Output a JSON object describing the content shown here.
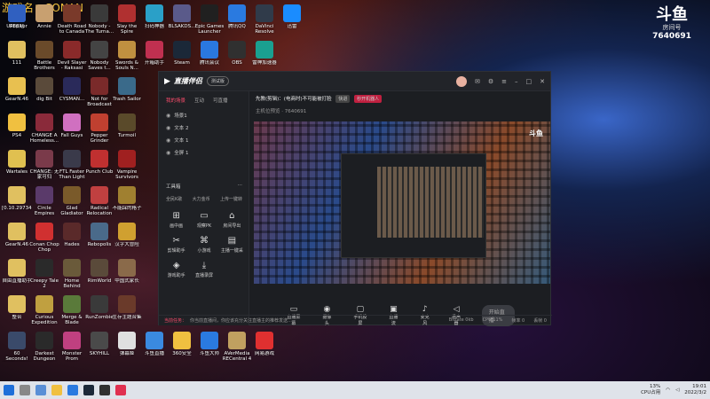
{
  "overlay": {
    "name": "游戏名：CONAN",
    "logo": "斗鱼",
    "room_label": "房间号",
    "room_id": "7640691"
  },
  "desktop_icons": [
    {
      "label": "回收站",
      "color": "#5a8fd6"
    },
    {
      "label": "Annie",
      "color": "#c8a070"
    },
    {
      "label": "Death Road to Canada",
      "color": "#7a3a2a"
    },
    {
      "label": "Nobody - The Turna...",
      "color": "#3a3a3a"
    },
    {
      "label": "Slay the Spire",
      "color": "#b03030"
    },
    {
      "label": "扫码神器",
      "color": "#2aa0c8"
    },
    {
      "label": "BLSAKDS...",
      "color": "#5a5a8a"
    },
    {
      "label": "Epic Games Launcher",
      "color": "#202020"
    },
    {
      "label": "腾讯QQ",
      "color": "#2a7ae0"
    },
    {
      "label": "DaVinci Resolve",
      "color": "#303b4a"
    },
    {
      "label": "迅雷",
      "color": "#1a8cff"
    },
    {
      "label": "111",
      "color": "#e0c060"
    },
    {
      "label": "Battle Brothers",
      "color": "#6a4a2a"
    },
    {
      "label": "Devil Slayer - Raksasi",
      "color": "#8a2a2a"
    },
    {
      "label": "Nobody Saves t...",
      "color": "#444"
    },
    {
      "label": "Swords & Souls N...",
      "color": "#c09040"
    },
    {
      "label": "开箱助手",
      "color": "#c03050"
    },
    {
      "label": "Steam",
      "color": "#1b2838"
    },
    {
      "label": "腾讯会议",
      "color": "#2a78e0"
    },
    {
      "label": "OBS",
      "color": "#303030"
    },
    {
      "label": "雷神加速器",
      "color": "#1aa090"
    },
    {
      "label": "GearN.46",
      "color": "#e8c050"
    },
    {
      "label": "dig Bit",
      "color": "#5a4a3a"
    },
    {
      "label": "CYSMAN...",
      "color": "#2a2a5a"
    },
    {
      "label": "Not for Broadcast",
      "color": "#7a2a2a"
    },
    {
      "label": "Trash Sailor",
      "color": "#3a6a8a"
    },
    {
      "label": "PS4",
      "color": "#f0c040"
    },
    {
      "label": "CHANGE A Homeless...",
      "color": "#8a2a3a"
    },
    {
      "label": "Fall Guys",
      "color": "#d070c0"
    },
    {
      "label": "Pepper Grinder",
      "color": "#c04030"
    },
    {
      "label": "Turmoil",
      "color": "#5a4a2a"
    },
    {
      "label": "Wartales",
      "color": "#e0c050"
    },
    {
      "label": "CHANGE: 无家可归",
      "color": "#7a3a4a"
    },
    {
      "label": "FTL Faster Than Light",
      "color": "#3a3a4a"
    },
    {
      "label": "Punch Club",
      "color": "#c03030"
    },
    {
      "label": "Vampire Survivors",
      "color": "#a02020"
    },
    {
      "label": "[0.10.29734]",
      "color": "#e0c060"
    },
    {
      "label": "Circle Empires",
      "color": "#5a3a6a"
    },
    {
      "label": "Glad Gladiator",
      "color": "#7a5a2a"
    },
    {
      "label": "Radical Relocation",
      "color": "#c04040"
    },
    {
      "label": "不能踩的格子",
      "color": "#a08030"
    },
    {
      "label": "GearN.46",
      "color": "#e0c060"
    },
    {
      "label": "Conan Chop Chop",
      "color": "#d03030"
    },
    {
      "label": "Hades",
      "color": "#5a2a2a"
    },
    {
      "label": "Rebopolis",
      "color": "#4a6a8a"
    },
    {
      "label": "汉字大冒险",
      "color": "#d0a030"
    },
    {
      "label": "自由直播助手",
      "color": "#e0c060"
    },
    {
      "label": "Creepy Tale 2",
      "color": "#2a2a2a"
    },
    {
      "label": "Home Behind",
      "color": "#6a5a3a"
    },
    {
      "label": "RimWorld",
      "color": "#5a4a3a"
    },
    {
      "label": "中国式家长",
      "color": "#8a6a4a"
    },
    {
      "label": "整合",
      "color": "#e0c060"
    },
    {
      "label": "Curious Expedition",
      "color": "#c0a040"
    },
    {
      "label": "Merge & Blade",
      "color": "#5a7a3a"
    },
    {
      "label": "RunZombie",
      "color": "#3a3a3a"
    },
    {
      "label": "生存主题合集",
      "color": "#6a3a2a"
    },
    {
      "label": "60 Seconds! Reatomized",
      "color": "#3a4a6a"
    },
    {
      "label": "Darkest Dungeon",
      "color": "#2a2a2a"
    },
    {
      "label": "Monster Prom",
      "color": "#c04080"
    },
    {
      "label": "SKYHILL",
      "color": "#4a4a4a"
    },
    {
      "label": "弹幕姬",
      "color": "#e0e0e0"
    },
    {
      "label": "斗鱼直播",
      "color": "#3a8ae0"
    },
    {
      "label": "360安全",
      "color": "#f0c040"
    },
    {
      "label": "斗鱼大师",
      "color": "#2a7ae0"
    },
    {
      "label": "AVerMedia RECentral 4",
      "color": "#c0a060"
    },
    {
      "label": "网易游戏",
      "color": "#e03030"
    },
    {
      "label": "UPEditor",
      "color": "#3060c0"
    }
  ],
  "app": {
    "title": "直播伴侣",
    "version": "测试版",
    "sidebar_tabs": [
      "我的场景",
      "互动",
      "可直播"
    ],
    "scenes": [
      "场景1",
      "文本 2",
      "文本 1",
      "全屏 1"
    ],
    "toolbox_title": "工具箱",
    "toolbox_links": [
      "全民K歌",
      "大力金币",
      "上传一键转"
    ],
    "tools": [
      {
        "glyph": "⊞",
        "label": "画中画"
      },
      {
        "glyph": "▭",
        "label": "观察PK"
      },
      {
        "glyph": "⌂",
        "label": "房间导出"
      },
      {
        "glyph": "✂",
        "label": "剪辑助手"
      },
      {
        "glyph": "⌘",
        "label": "小游戏"
      },
      {
        "glyph": "▤",
        "label": "主播一键采"
      },
      {
        "glyph": "◈",
        "label": "游戏助手"
      },
      {
        "glyph": "⤓",
        "label": "直播录屏"
      }
    ],
    "live_title": "先教(剪辑)：(电商时)不可能被打脸",
    "tags": [
      {
        "text": "快进",
        "color": "#444"
      },
      {
        "text": "秒开机器人",
        "color": "#c02040"
      }
    ],
    "info_line": "主机位预览",
    "room_info": "7640691",
    "controls": [
      {
        "glyph": "▭",
        "label": "直播屏幕"
      },
      {
        "glyph": "◉",
        "label": "摄像头"
      },
      {
        "glyph": "▢",
        "label": "手机投屏"
      },
      {
        "glyph": "▣",
        "label": "直播流"
      },
      {
        "glyph": "♪",
        "label": "麦克风"
      },
      {
        "glyph": "◁",
        "label": "扬声器"
      }
    ],
    "start_label": "开始直播",
    "notice_prefix": "当前任务：",
    "notice": "你当前直播间，你应该充分关注直播主的推荐发送…",
    "status": [
      "Bitrate 0kb",
      "CPU 11%",
      "帧率 0",
      "丢帧 0"
    ]
  },
  "taskbar": {
    "cpu": "13%",
    "cpu_label": "CPU占用",
    "time": "19:01",
    "date": "2022/3/2"
  }
}
